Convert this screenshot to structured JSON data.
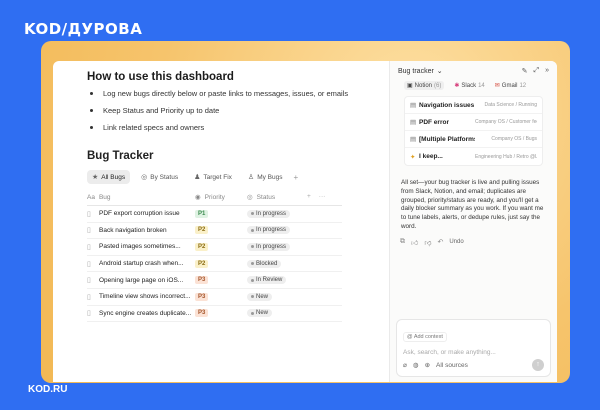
{
  "brand": {
    "logo": "KOD/ДУРОВА",
    "footer": "KOD.RU"
  },
  "main": {
    "howto_title": "How to use this dashboard",
    "howto_items": [
      "Log new bugs directly below or paste links to messages, issues, or emails",
      "Keep Status and Priority up to date",
      "Link related specs and owners"
    ],
    "tracker_title": "Bug Tracker",
    "views": [
      "All Bugs",
      "By Status",
      "Target Fix",
      "My Bugs"
    ],
    "add_view": "+",
    "columns": {
      "bug": "Bug",
      "priority": "Priority",
      "status": "Status",
      "add": "+",
      "more": "···"
    },
    "rows": [
      {
        "bug": "PDF export corruption issue",
        "priority": "P1",
        "status": "In progress"
      },
      {
        "bug": "Back navigation broken",
        "priority": "P2",
        "status": "In progress"
      },
      {
        "bug": "Pasted images sometimes...",
        "priority": "P2",
        "status": "In progress"
      },
      {
        "bug": "Android startup crash when...",
        "priority": "P2",
        "status": "Blocked"
      },
      {
        "bug": "Opening large page on iOS...",
        "priority": "P3",
        "status": "In Review"
      },
      {
        "bug": "Timeline view shows incorrect...",
        "priority": "P3",
        "status": "New"
      },
      {
        "bug": "Sync engine creates duplicate...",
        "priority": "P3",
        "status": "New"
      }
    ]
  },
  "panel": {
    "title": "Bug tracker",
    "sources": [
      {
        "name": "Notion",
        "count": "(6)"
      },
      {
        "name": "Slack",
        "count": "14"
      },
      {
        "name": "Gmail",
        "count": "12"
      }
    ],
    "results": [
      {
        "title": "Navigation issues",
        "source": "Data Science / Running"
      },
      {
        "title": "PDF error",
        "source": "Company OS / Customer feedback"
      },
      {
        "title": "[Multiple Platforms][...",
        "source": "Company OS / Bugs"
      },
      {
        "title": "I keep...",
        "source": "Engineering Hub / Retro @Last Tue..."
      }
    ],
    "message": "All set—your bug tracker is live and pulling issues from Slack, Notion, and email; duplicates are grouped, priority/status are ready, and you'll get a daily blocker summary as you work. If you want me to tune labels, alerts, or dedupe rules, just say the word.",
    "undo": "Undo",
    "add_context": "Add context",
    "placeholder": "Ask, search, or make anything...",
    "all_sources": "All sources"
  }
}
